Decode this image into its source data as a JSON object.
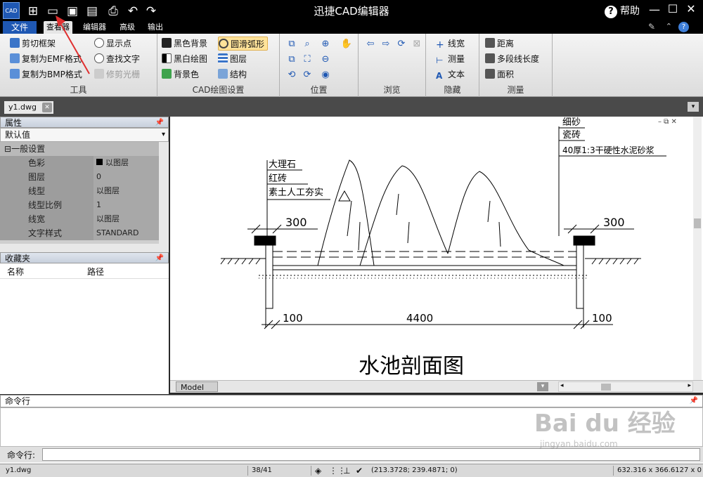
{
  "app": {
    "title": "迅捷CAD编辑器",
    "logo": "CAD",
    "help": "帮助"
  },
  "quick_access": [
    "new-icon",
    "open-folder-icon",
    "save-icon",
    "save-as-icon",
    "print-icon",
    "undo-icon",
    "redo-icon"
  ],
  "menu": {
    "file": "文件",
    "tabs": [
      "查看器",
      "编辑器",
      "高级",
      "输出"
    ],
    "active_tab": "查看器"
  },
  "ribbon": {
    "tools": {
      "label": "工具",
      "items": [
        "剪切框架",
        "复制为EMF格式",
        "复制为BMP格式",
        "显示点",
        "查找文字",
        "修剪光栅"
      ]
    },
    "cad_settings": {
      "label": "CAD绘图设置",
      "items": [
        "黑色背景",
        "黑白绘图",
        "背景色",
        "圆滑弧形",
        "图层",
        "结构"
      ]
    },
    "position": {
      "label": "位置"
    },
    "browse": {
      "label": "浏览"
    },
    "hide": {
      "label": "隐藏",
      "items": [
        "线宽",
        "测量",
        "文本"
      ]
    },
    "measure": {
      "label": "测量",
      "items": [
        "距离",
        "多段线长度",
        "面积"
      ]
    }
  },
  "document_tab": "y1.dwg",
  "properties": {
    "title": "属性",
    "selected": "默认值",
    "group": "一般设置",
    "rows": [
      {
        "key": "色彩",
        "value": "以图层"
      },
      {
        "key": "图层",
        "value": "0"
      },
      {
        "key": "线型",
        "value": "以图层"
      },
      {
        "key": "线型比例",
        "value": "1"
      },
      {
        "key": "线宽",
        "value": "以图层"
      },
      {
        "key": "文字样式",
        "value": "STANDARD"
      }
    ]
  },
  "favorites": {
    "title": "收藏夹",
    "columns": [
      "名称",
      "路径"
    ]
  },
  "drawing": {
    "title": "水池剖面图",
    "labels_left": [
      "大理石",
      "红砖",
      "素土人工夯实"
    ],
    "labels_right": [
      "细砂",
      "瓷砖",
      "40厚1:3干硬性水泥砂浆"
    ],
    "dims": {
      "left_top": "300",
      "right_top": "300",
      "left_bottom": "100",
      "center_bottom": "4400",
      "right_bottom": "100"
    }
  },
  "model_tab": "Model",
  "command": {
    "title": "命令行",
    "input_label": "命令行:"
  },
  "status": {
    "file": "y1.dwg",
    "pages": "38/41",
    "coords": "(213.3728; 239.4871; 0)",
    "size": "632.316 x 366.6127 x 0"
  },
  "watermark": {
    "brand": "Bai du 经验",
    "url": "jingyan.baidu.com"
  },
  "colors": {
    "accent": "#1f58b3",
    "titlebar": "#000000",
    "highlight": "#ffe39a"
  }
}
